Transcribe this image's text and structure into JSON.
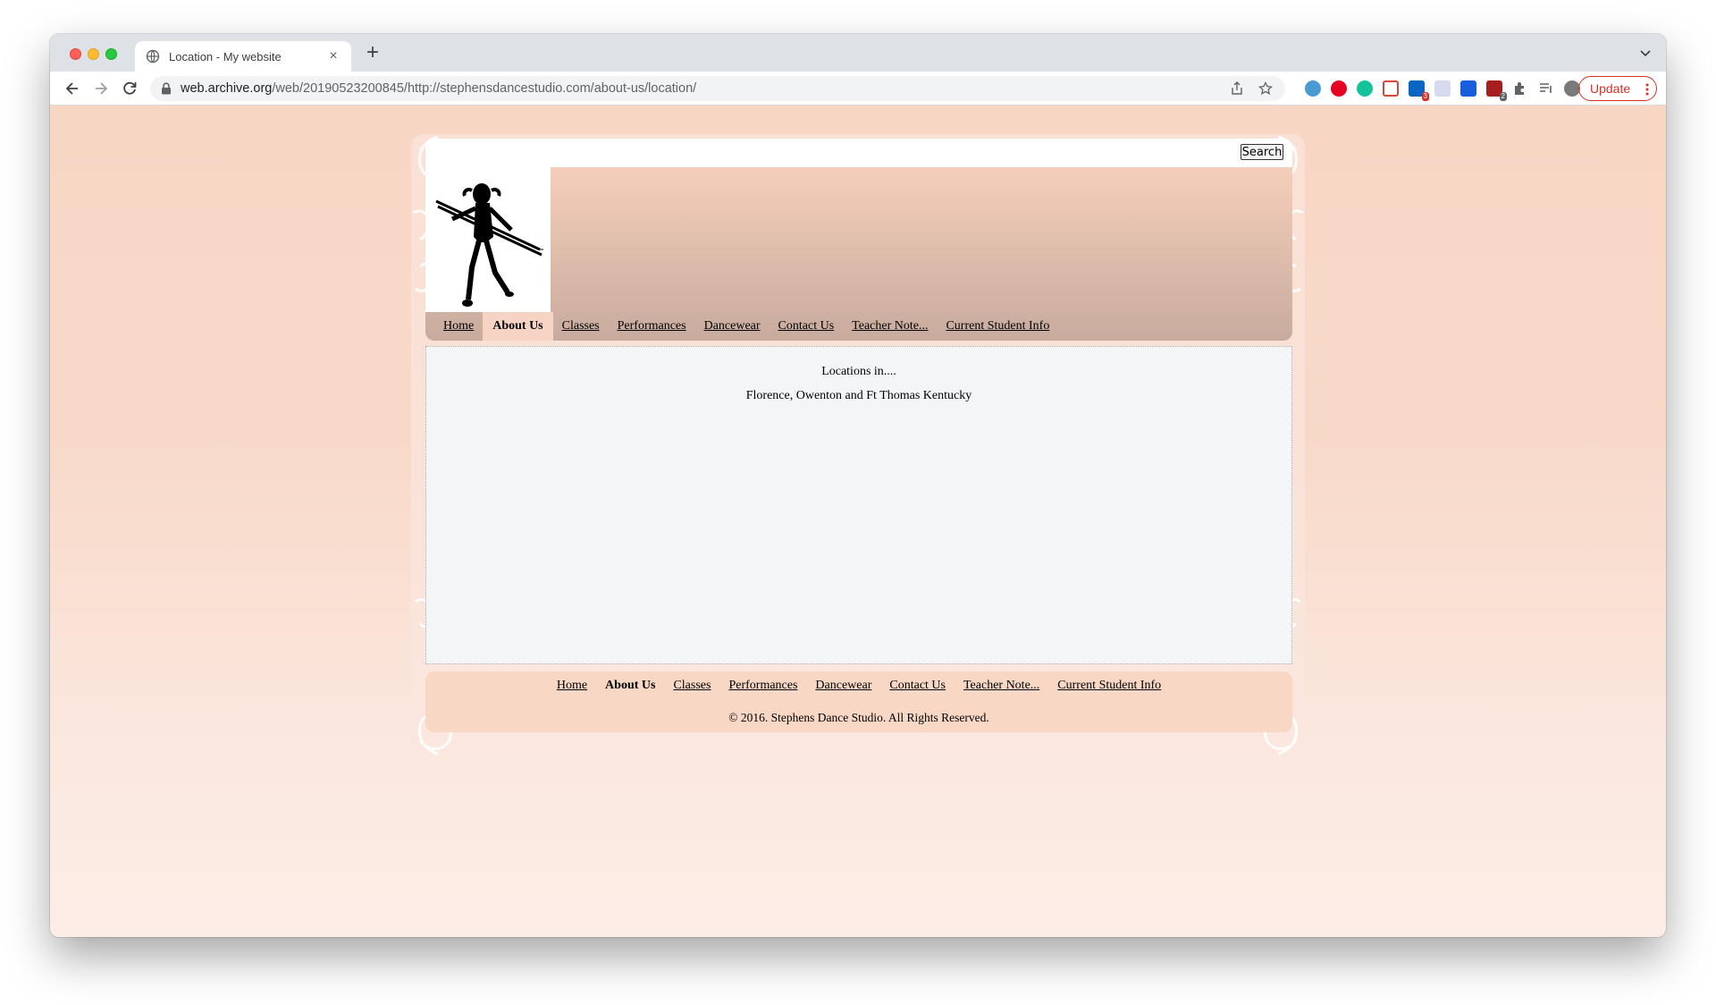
{
  "browser": {
    "tab_title": "Location - My website",
    "url_host": "web.archive.org",
    "url_path": "/web/20190523200845/http://stephensdancestudio.com/about-us/location/",
    "update_label": "Update",
    "extension_badges": [
      "3",
      "2"
    ]
  },
  "site": {
    "search_button": "Search",
    "nav": [
      "Home",
      "About Us",
      "Classes",
      "Performances",
      "Dancewear",
      "Contact Us",
      "Teacher Note...",
      "Current Student Info"
    ],
    "active_nav": "About Us",
    "content": {
      "line1": "Locations in....",
      "line2": "Florence, Owenton and Ft Thomas Kentucky"
    },
    "footer_nav": [
      "Home",
      "About Us",
      "Classes",
      "Performances",
      "Dancewear",
      "Contact Us",
      "Teacher Note...",
      "Current Student Info"
    ],
    "copyright": "© 2016. Stephens Dance Studio. All Rights Reserved."
  },
  "colors": {
    "page_bg": "#f8d6c4",
    "header_top": "#f5cfba",
    "header_bottom": "#c8ab9e",
    "content_bg": "#f4f5f7",
    "update_red": "#d93025"
  }
}
